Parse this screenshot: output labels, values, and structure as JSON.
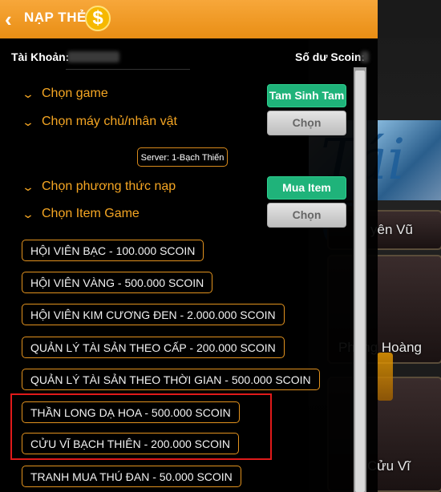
{
  "header": {
    "back_glyph": "‹",
    "title": "NẠP THẺ",
    "coin_glyph": "$"
  },
  "account": {
    "account_label": "Tài Khoản:",
    "balance_label": "Số dư Scoin:"
  },
  "rows": {
    "game_label": "Chọn game",
    "game_value": "Tam Sinh Tam",
    "server_label": "Chọn máy chủ/nhân vật",
    "server_button": "Chọn",
    "server_badge": "Server: 1-Bạch Thiến",
    "method_label": "Chọn phương thức nạp",
    "method_value": "Mua Item",
    "item_label": "Chọn Item Game",
    "item_button": "Chọn"
  },
  "items": [
    "HỘI VIÊN BẠC - 100.000 SCOIN",
    "HỘI VIÊN VÀNG - 500.000 SCOIN",
    "HỘI VIÊN KIM CƯƠNG ĐEN - 2.000.000 SCOIN",
    "QUẢN LÝ TÀI SẢN THEO CẤP - 200.000 SCOIN",
    "QUẢN LÝ TÀI SẢN THEO THỜI GIAN - 500.000 SCOIN",
    "THẦN LONG DẠ HOA - 500.000 SCOIN",
    "CỬU VĨ BẠCH THIÊN - 200.000 SCOIN",
    "TRANH MUA THÚ ĐAN - 50.000 SCOIN"
  ],
  "background_cards": {
    "card1": "yên Vũ",
    "card2": "Phụng Hoàng",
    "card3": "Cửu Vĩ"
  },
  "colors": {
    "header": "#f39a1f",
    "accent": "#f5a623",
    "green": "#1fb37a",
    "highlight": "#e01a1a"
  },
  "icons": [
    "back-arrow-icon",
    "coin-icon",
    "chevron-down-icon"
  ]
}
